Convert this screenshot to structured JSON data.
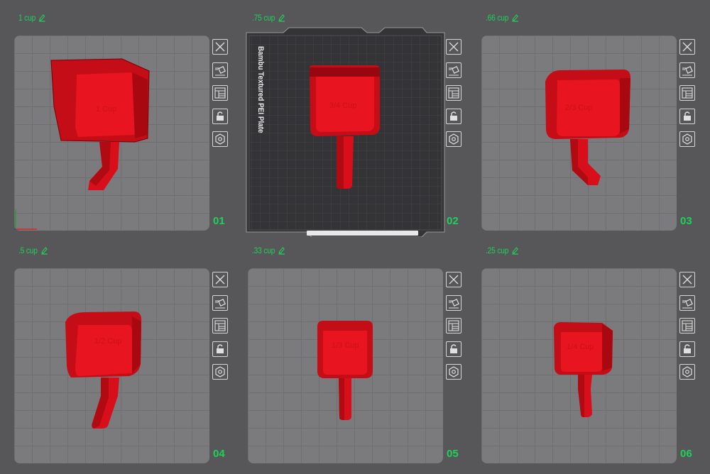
{
  "plates": [
    {
      "name": "1 cup",
      "number": "01",
      "engraving": "1 Cup"
    },
    {
      "name": ".75 cup",
      "number": "02",
      "engraving": "3/4 Cup"
    },
    {
      "name": ".66 cup",
      "number": "03",
      "engraving": "2/3 Cup"
    },
    {
      "name": ".5 cup",
      "number": "04",
      "engraving": "1/2 Cup"
    },
    {
      "name": ".33 cup",
      "number": "05",
      "engraving": "1/3 Cup"
    },
    {
      "name": ".25 cup",
      "number": "06",
      "engraving": "1/4 Cup"
    }
  ],
  "bed_label": "Bambu Textured PEI Plate",
  "toolbar_icons": [
    "delete-icon",
    "auto-orient-icon",
    "arrange-icon",
    "lock-icon",
    "settings-icon"
  ],
  "colors": {
    "background": "#575759",
    "bed": "#7b7b7e",
    "accent_green": "#1fd05a",
    "model_red": "#e0101c"
  }
}
